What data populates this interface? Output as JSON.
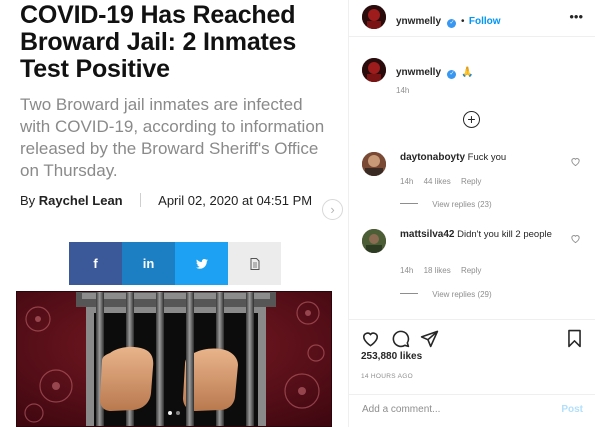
{
  "article": {
    "headline": "COVID-19 Has Reached Broward Jail: 2 Inmates Test Positive",
    "dek": "Two Broward jail inmates are infected with COVID-19, according to information released by the Broward Sheriff's Office on Thursday.",
    "by_prefix": "By",
    "author": "Raychel Lean",
    "date": "April 02, 2020 at 04:51 PM",
    "share": {
      "facebook_icon": "f",
      "linkedin_icon": "in",
      "twitter_icon": "twitter-bird",
      "print_icon": "document"
    },
    "colors": {
      "facebook": "#3b5998",
      "linkedin": "#1c7ec3",
      "twitter": "#1da1f2"
    }
  },
  "post": {
    "username": "ynwmelly",
    "follow_label": "Follow",
    "follow_separator": "•",
    "more_icon": "•••",
    "caption_emoji": "🙏",
    "caption_time": "14h",
    "comments": [
      {
        "username": "daytonaboyty",
        "text": "Fuck you",
        "time": "14h",
        "likes": "44 likes",
        "reply": "Reply",
        "view_replies": "View replies (23)"
      },
      {
        "username": "mattsilva42",
        "text": "Didn't you kill 2 people",
        "time": "14h",
        "likes": "18 likes",
        "reply": "Reply",
        "view_replies": "View replies (29)"
      }
    ],
    "likes": "253,880 likes",
    "timestamp": "14 HOURS AGO",
    "comment_placeholder": "Add a comment...",
    "post_label": "Post",
    "colors": {
      "accent": "#0095f6",
      "verified": "#3897f0",
      "post_disabled": "#b2dffc"
    }
  }
}
